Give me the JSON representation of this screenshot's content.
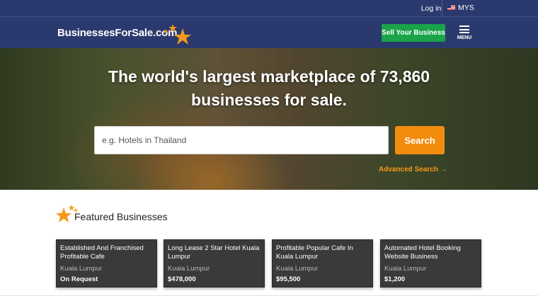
{
  "topbar": {
    "login_label": "Log in",
    "region_label": "MYS"
  },
  "header": {
    "logo_text": "BusinessesForSale.com",
    "sell_button_label": "Sell Your Business",
    "menu_label": "MENU"
  },
  "hero": {
    "headline_line1": "The world's largest marketplace of 73,860",
    "headline_line2": "businesses for sale.",
    "search_placeholder": "e.g. Hotels in Thailand",
    "search_button_label": "Search",
    "advanced_search_label": "Advanced Search →"
  },
  "featured": {
    "title": "Featured Businesses",
    "items": [
      {
        "title": "Established And Franchised Profitable Cafe",
        "location": "Kuala Lumpur",
        "price": "On Request"
      },
      {
        "title": "Long Lease 2 Star Hotel Kuala Lumpur",
        "location": "Kuala Lumpur",
        "price": "$478,000"
      },
      {
        "title": "Profitable Popular Cafe In Kuala Lumpur",
        "location": "Kuala Lumpur",
        "price": "$95,500"
      },
      {
        "title": "Automated Hotel Booking Website Business",
        "location": "Kuala Lumpur",
        "price": "$1,200"
      }
    ]
  },
  "colors": {
    "header_bg": "#2b3a6e",
    "sell_button": "#1aa34a",
    "search_button": "#f28c0f",
    "star_accent": "#f39a1c",
    "card_bg": "#3a3a3a"
  },
  "icons": [
    "flag-icon",
    "star-icon",
    "hamburger-menu-icon",
    "arrow-right-icon"
  ]
}
